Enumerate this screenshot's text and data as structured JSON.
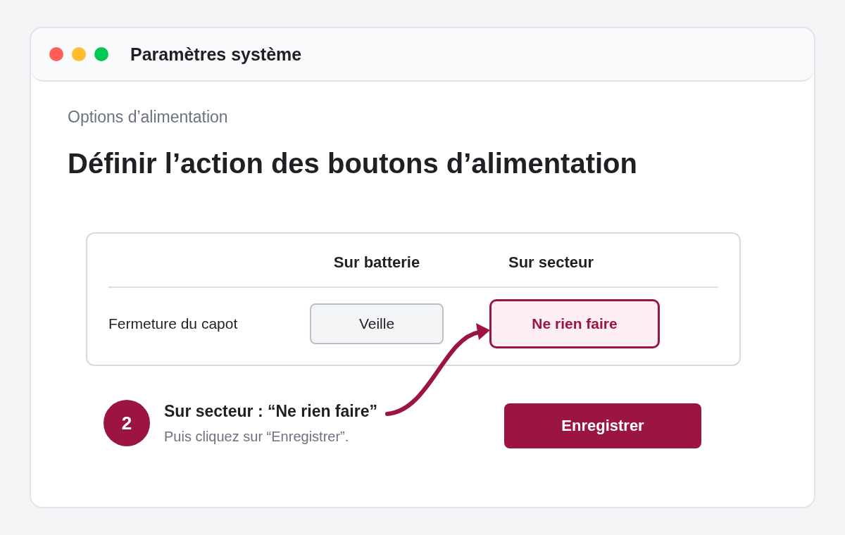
{
  "window": {
    "title": "Paramètres système"
  },
  "breadcrumb": "Options d’alimentation",
  "heading": "Définir l’action des boutons d’alimentation",
  "settings_table": {
    "columns": [
      "Sur batterie",
      "Sur secteur"
    ],
    "rows": [
      {
        "label": "Fermeture du capot",
        "values": [
          {
            "text": "Veille",
            "highlighted": false
          },
          {
            "text": "Ne rien faire",
            "highlighted": true
          }
        ]
      }
    ]
  },
  "step": {
    "number": "2",
    "title": "Sur secteur : “Ne rien faire”",
    "hint": "Puis cliquez sur “Enregistrer”."
  },
  "save_button": "Enregistrer"
}
